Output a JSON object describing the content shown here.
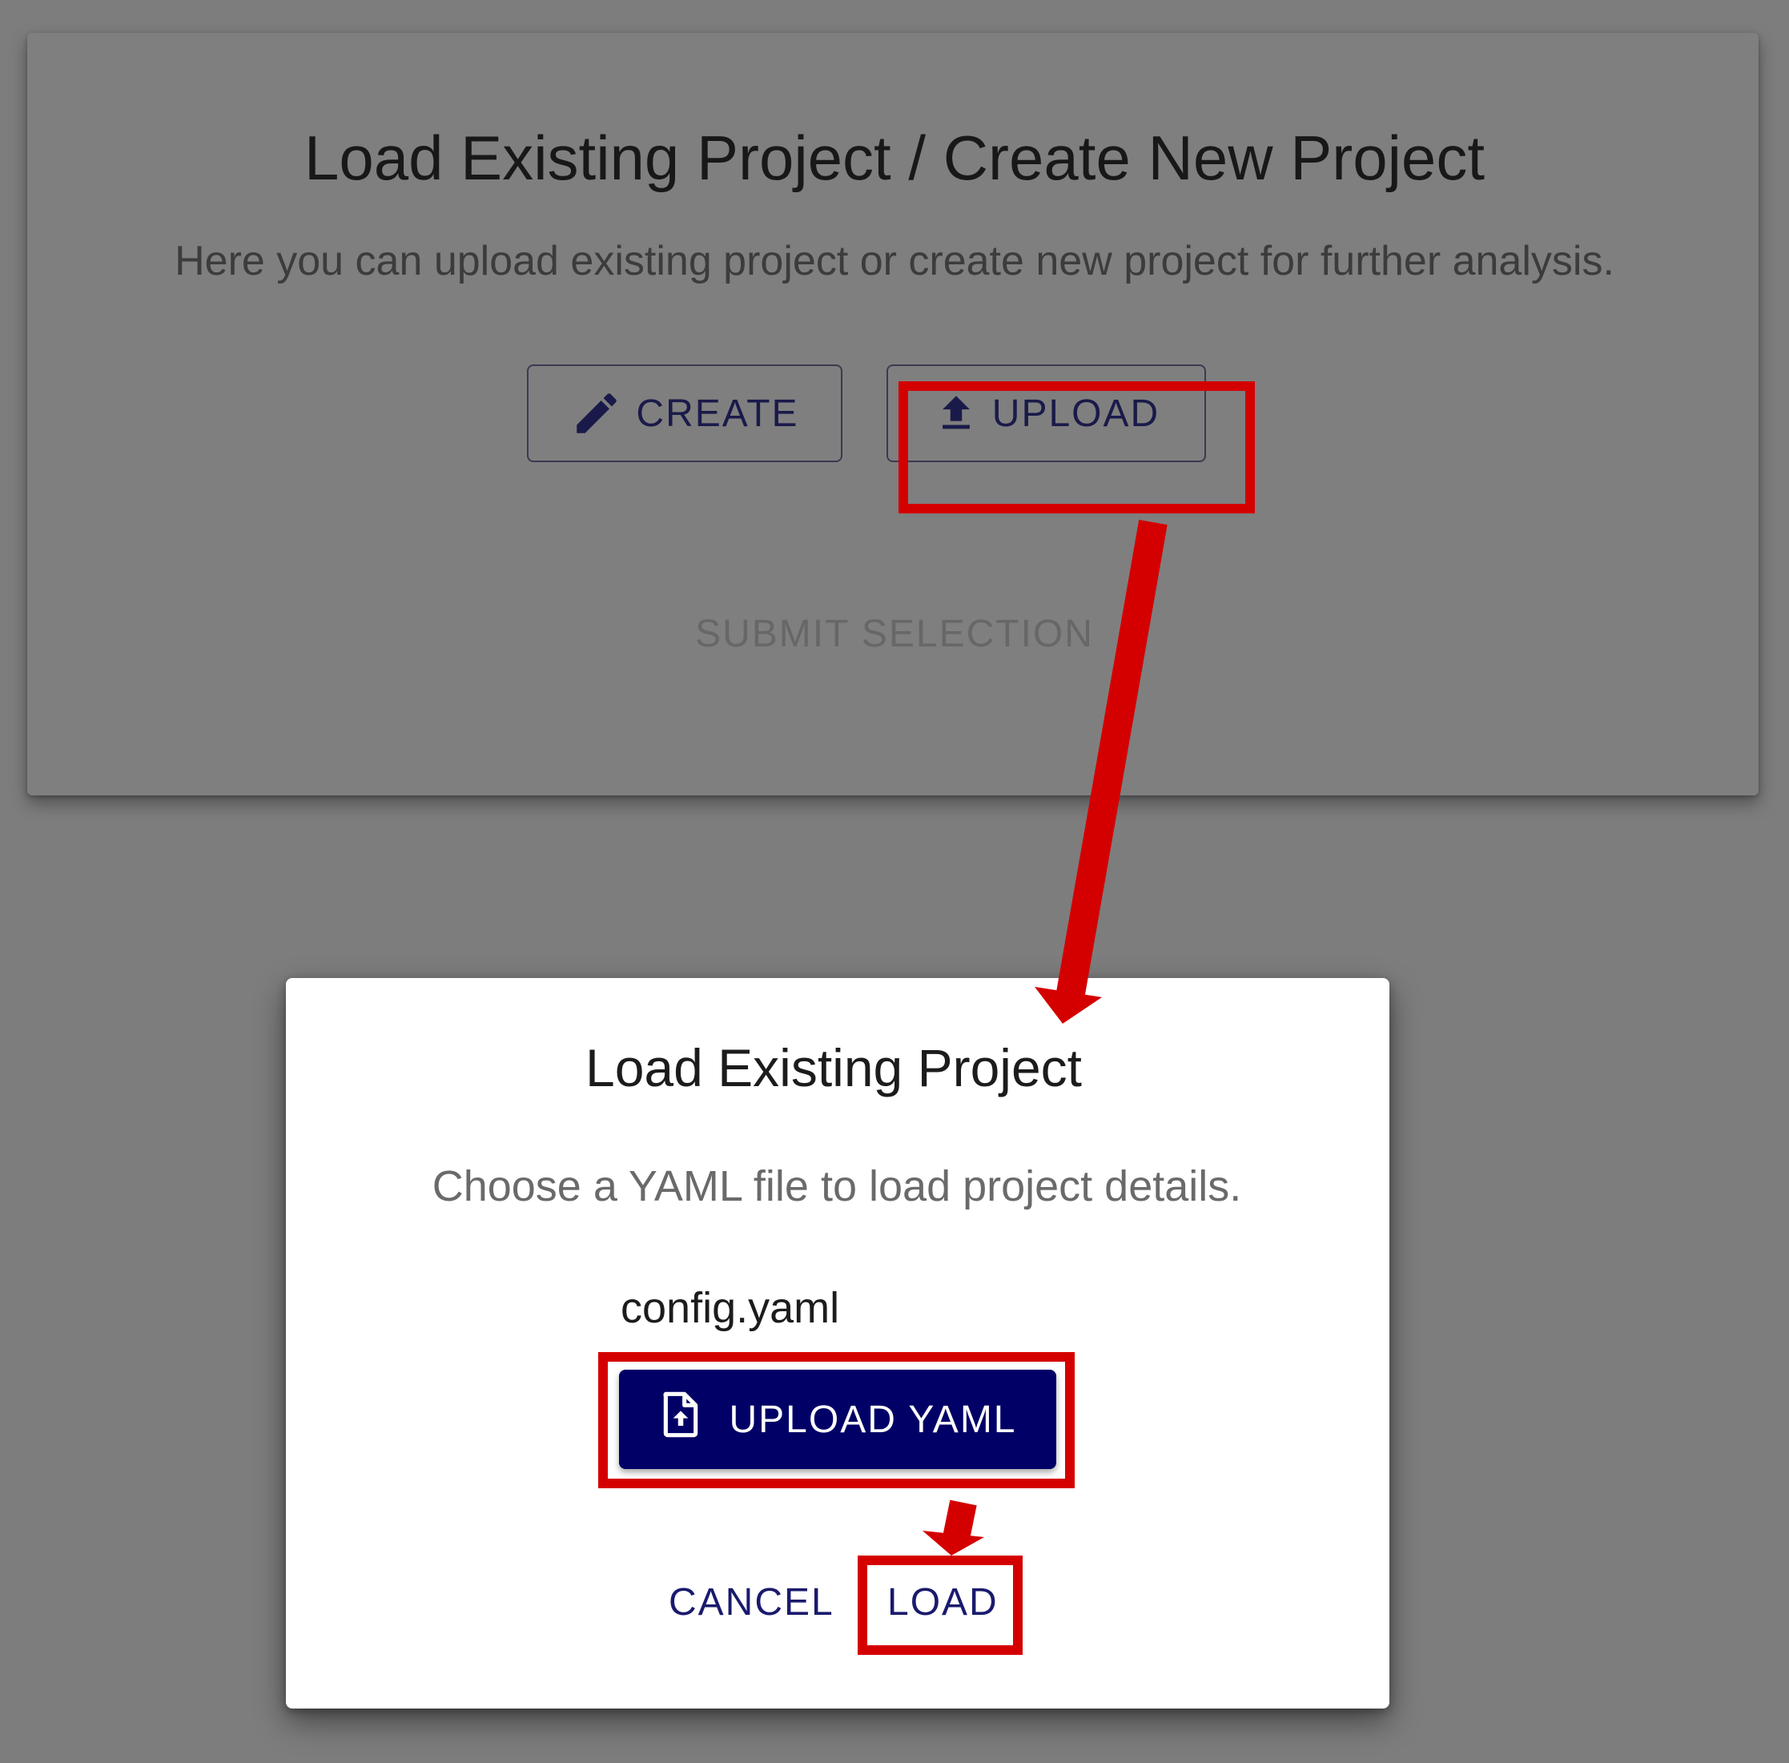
{
  "background_card": {
    "title": "Load Existing Project / Create New Project",
    "subtitle": "Here you can upload existing project or create new project for further analysis.",
    "create_label": "CREATE",
    "upload_label": "UPLOAD",
    "submit_label": "SUBMIT SELECTION"
  },
  "dialog": {
    "title": "Load Existing Project",
    "description": "Choose a YAML file to load project details.",
    "file_name": "config.yaml",
    "upload_yaml_label": "UPLOAD YAML",
    "cancel_label": "CANCEL",
    "load_label": "LOAD"
  },
  "icons": {
    "create": "pencil-icon",
    "upload": "upload-icon",
    "upload_yaml": "file-upload-icon"
  },
  "colors": {
    "backdrop": "#7d7d7d",
    "primary": "#000066",
    "text_button": "#1a1a6e",
    "annotation": "#d40000"
  }
}
